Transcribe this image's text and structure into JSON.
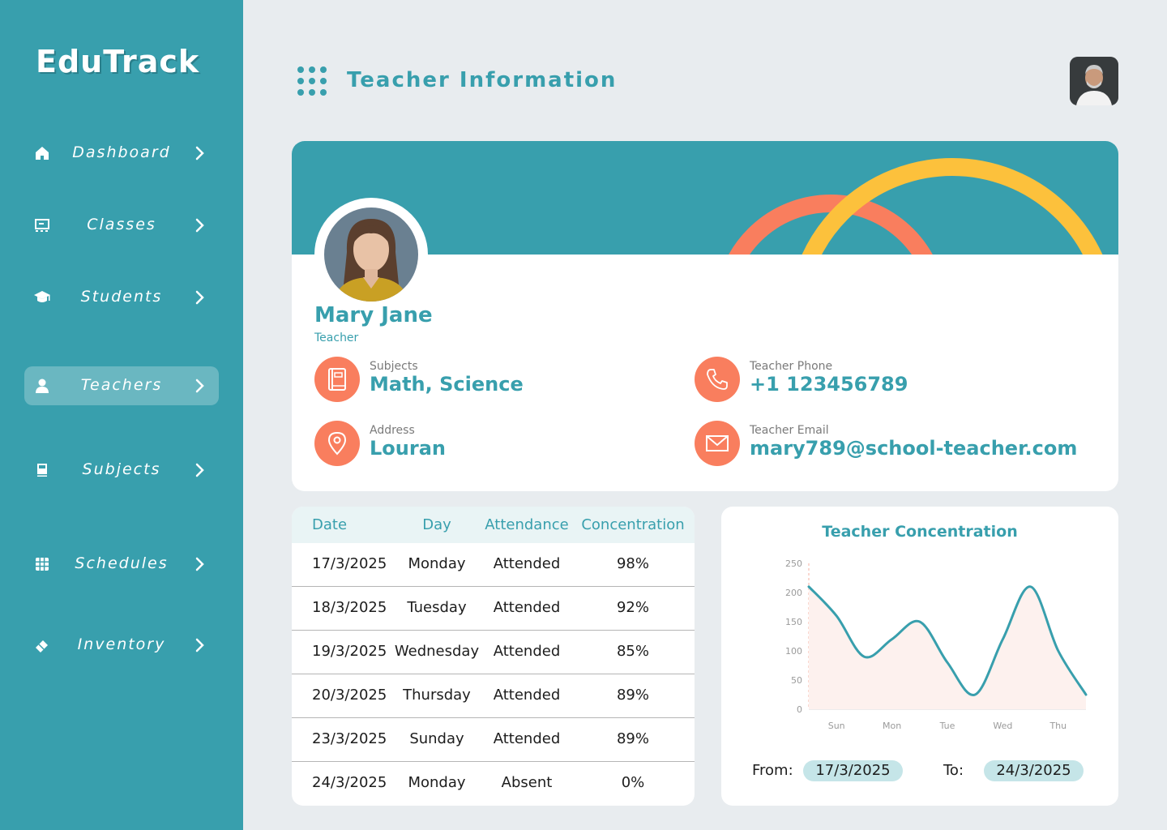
{
  "app": {
    "logo": "EduTrack"
  },
  "sidebar": {
    "items": [
      {
        "label": "Dashboard",
        "icon": "home-icon"
      },
      {
        "label": "Classes",
        "icon": "classes-icon"
      },
      {
        "label": "Students",
        "icon": "graduation-cap-icon"
      },
      {
        "label": "Teachers",
        "icon": "person-icon",
        "active": true
      },
      {
        "label": "Subjects",
        "icon": "book-icon"
      },
      {
        "label": "Schedules",
        "icon": "grid-icon"
      },
      {
        "label": "Inventory",
        "icon": "eraser-icon"
      }
    ]
  },
  "header": {
    "title": "Teacher Information"
  },
  "profile": {
    "name": "Mary Jane",
    "role": "Teacher",
    "subjects_label": "Subjects",
    "subjects_value": "Math, Science",
    "phone_label": "Teacher Phone",
    "phone_value": "+1 123456789",
    "address_label": "Address",
    "address_value": "Louran",
    "email_label": "Teacher Email",
    "email_value": "mary789@school-teacher.com"
  },
  "attendance": {
    "headers": [
      "Date",
      "Day",
      "Attendance",
      "Concentration"
    ],
    "rows": [
      [
        "17/3/2025",
        "Monday",
        "Attended",
        "98%"
      ],
      [
        "18/3/2025",
        "Tuesday",
        "Attended",
        "92%"
      ],
      [
        "19/3/2025",
        "Wednesday",
        "Attended",
        "85%"
      ],
      [
        "20/3/2025",
        "Thursday",
        "Attended",
        "89%"
      ],
      [
        "23/3/2025",
        "Sunday",
        "Attended",
        "89%"
      ],
      [
        "24/3/2025",
        "Monday",
        "Absent",
        "0%"
      ]
    ]
  },
  "chart": {
    "from_label": "From:",
    "from_value": "17/3/2025",
    "to_label": "To:",
    "to_value": "24/3/2025"
  },
  "chart_data": {
    "type": "area",
    "title": "Teacher Concentration",
    "categories": [
      "Sun",
      "Mon",
      "Tue",
      "Wed",
      "Thu"
    ],
    "x": [
      -0.5,
      0,
      0.5,
      1,
      1.5,
      2,
      2.5,
      3,
      3.5,
      4,
      4.5
    ],
    "values": [
      210,
      160,
      90,
      120,
      150,
      80,
      25,
      120,
      210,
      100,
      25
    ],
    "yticks": [
      0,
      50,
      100,
      150,
      200,
      250
    ],
    "ylim": [
      0,
      250
    ],
    "xlabel": "",
    "ylabel": "",
    "line_color": "#389fad",
    "fill_color": "#fdf1ee"
  },
  "colors": {
    "primary": "#389fad",
    "accent": "#f97e5e",
    "yellow": "#fcc13c",
    "background": "#e8ecef"
  }
}
